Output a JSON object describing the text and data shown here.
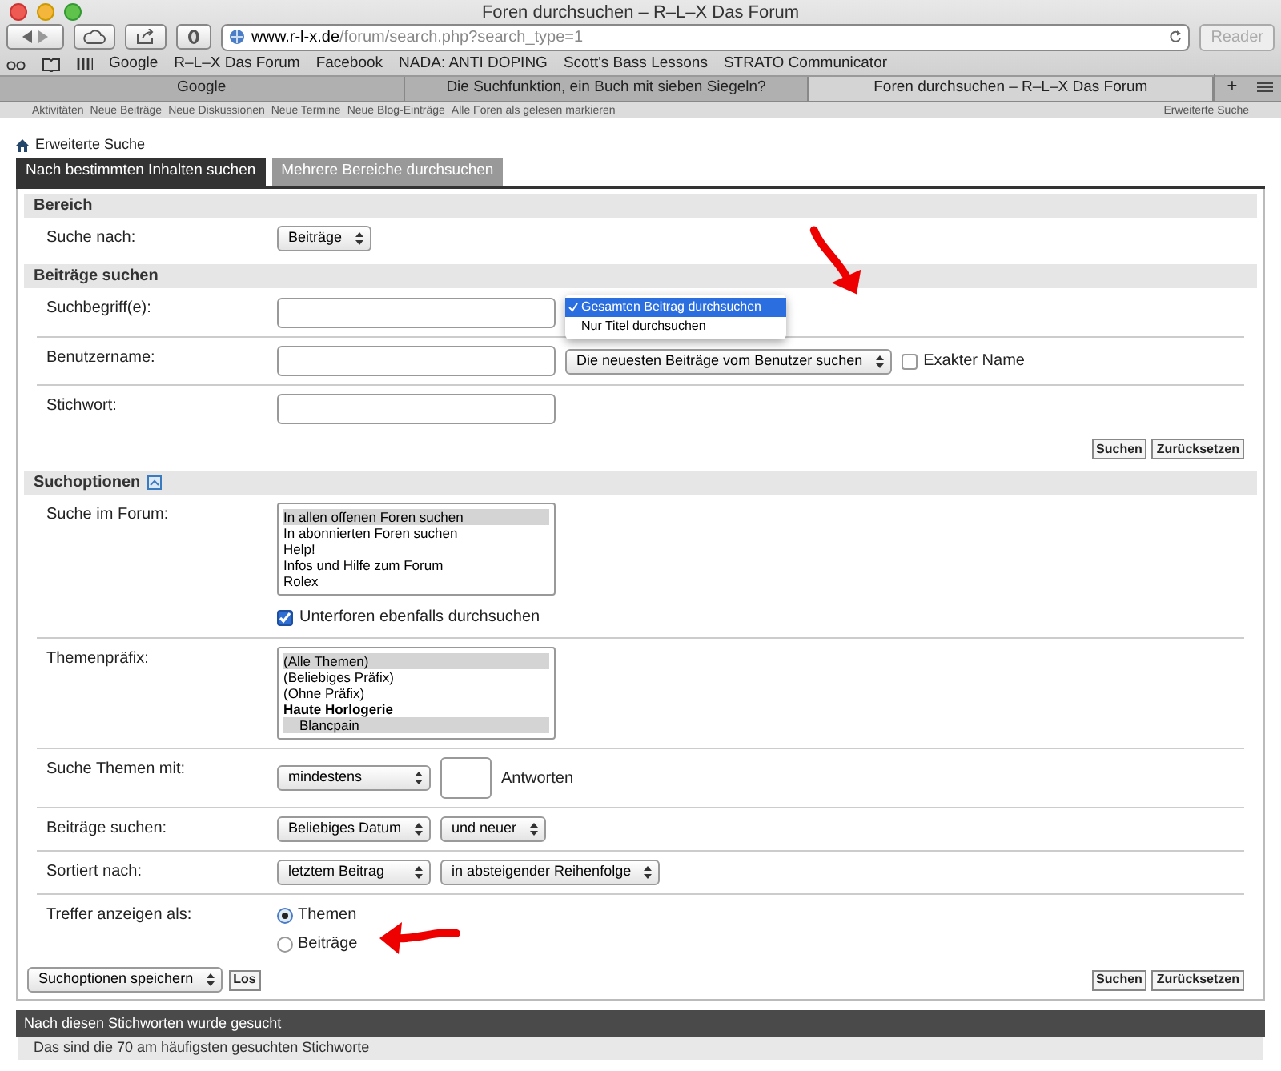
{
  "browser": {
    "title": "Foren durchsuchen – R–L–X Das Forum",
    "url": {
      "host": "www.r-l-x.de",
      "path": "/forum/search.php?search_type=1"
    },
    "reader": "Reader",
    "bookmarks": [
      "Google",
      "R–L–X Das Forum",
      "Facebook",
      "NADA: ANTI DOPING",
      "Scott's Bass Lessons",
      "STRATO Communicator"
    ],
    "tabs": [
      {
        "label": "Google",
        "selected": false
      },
      {
        "label": "Die Suchfunktion, ein Buch mit sieben Siegeln?",
        "selected": false
      },
      {
        "label": "Foren durchsuchen – R–L–X Das Forum",
        "selected": true
      }
    ],
    "tab_add": "+"
  },
  "nav_strip": {
    "links": [
      "Aktivitäten",
      "Neue Beiträge",
      "Neue Diskussionen",
      "Neue Termine",
      "Neue Blog-Einträge",
      "Alle Foren als gelesen markieren"
    ],
    "right": "Erweiterte Suche"
  },
  "breadcrumb": "Erweiterte Suche",
  "tabs": [
    {
      "label": "Nach bestimmten Inhalten suchen",
      "selected": true
    },
    {
      "label": "Mehrere Bereiche durchsuchen",
      "selected": false
    }
  ],
  "sections": [
    {
      "title": "Bereich",
      "rows": [
        {
          "label": "Suche nach:",
          "controls": [
            {
              "kind": "select",
              "value": "Beiträge"
            }
          ]
        }
      ]
    },
    {
      "title": "Beiträge suchen",
      "rows": [
        {
          "label": "Suchbegriff(e):",
          "controls": [
            {
              "kind": "input"
            },
            {
              "kind": "menu",
              "options": [
                {
                  "label": "Gesamten Beitrag durchsuchen",
                  "selected": true
                },
                {
                  "label": "Nur Titel durchsuchen",
                  "selected": false
                }
              ]
            }
          ]
        },
        {
          "label": "Benutzername:",
          "controls": [
            {
              "kind": "input"
            },
            {
              "kind": "select",
              "value": "Die neuesten Beiträge vom Benutzer suchen"
            },
            {
              "kind": "checkbox",
              "label": "Exakter Name",
              "checked": false
            }
          ]
        },
        {
          "label": "Stichwort:",
          "controls": [
            {
              "kind": "input"
            }
          ]
        }
      ],
      "buttons": [
        "Suchen",
        "Zurücksetzen"
      ]
    },
    {
      "title": "Suchoptionen",
      "expanded": true,
      "rows": [
        {
          "label": "Suche im Forum:",
          "controls": [
            {
              "kind": "listbox",
              "items": [
                {
                  "label": "In allen offenen Foren suchen",
                  "selected": true
                },
                {
                  "label": "In abonnierten Foren suchen",
                  "selected": false
                },
                {
                  "label": "Help!",
                  "selected": false
                },
                {
                  "label": "Infos und Hilfe zum Forum",
                  "selected": false
                },
                {
                  "label": "Rolex",
                  "selected": false
                }
              ]
            },
            {
              "kind": "checkbox",
              "label": "Unterforen ebenfalls durchsuchen",
              "checked": true
            }
          ]
        },
        {
          "label": "Themenpräfix:",
          "controls": [
            {
              "kind": "listbox",
              "items": [
                {
                  "label": "(Alle Themen)",
                  "selected": true
                },
                {
                  "label": "(Beliebiges Präfix)",
                  "selected": false
                },
                {
                  "label": "(Ohne Präfix)",
                  "selected": false
                },
                {
                  "label": "Haute Horlogerie",
                  "selected": false,
                  "children": [
                    {
                      "label": "Blancpain",
                      "selected": true
                    }
                  ]
                }
              ]
            }
          ]
        },
        {
          "label": "Suche Themen mit:",
          "controls": [
            {
              "kind": "select",
              "value": "mindestens"
            },
            {
              "kind": "input"
            },
            {
              "kind": "text",
              "value": "Antworten"
            }
          ]
        },
        {
          "label": "Beiträge suchen:",
          "controls": [
            {
              "kind": "select",
              "value": "Beliebiges Datum"
            },
            {
              "kind": "select",
              "value": "und neuer"
            }
          ]
        },
        {
          "label": "Sortiert nach:",
          "controls": [
            {
              "kind": "select",
              "value": "letztem Beitrag"
            },
            {
              "kind": "select",
              "value": "in absteigender Reihenfolge"
            }
          ]
        },
        {
          "label": "Treffer anzeigen als:",
          "controls": [
            {
              "kind": "radios",
              "options": [
                {
                  "label": "Themen",
                  "selected": true
                },
                {
                  "label": "Beiträge",
                  "selected": false
                }
              ]
            }
          ]
        }
      ],
      "footer": {
        "save": "Suchoptionen speichern",
        "go": "Los"
      },
      "buttons": [
        "Suchen",
        "Zurücksetzen"
      ]
    }
  ],
  "keywords": {
    "title": "Nach diesen Stichworten wurde gesucht",
    "subtitle": "Das sind die 70 am häufigsten gesuchten Stichworte"
  }
}
